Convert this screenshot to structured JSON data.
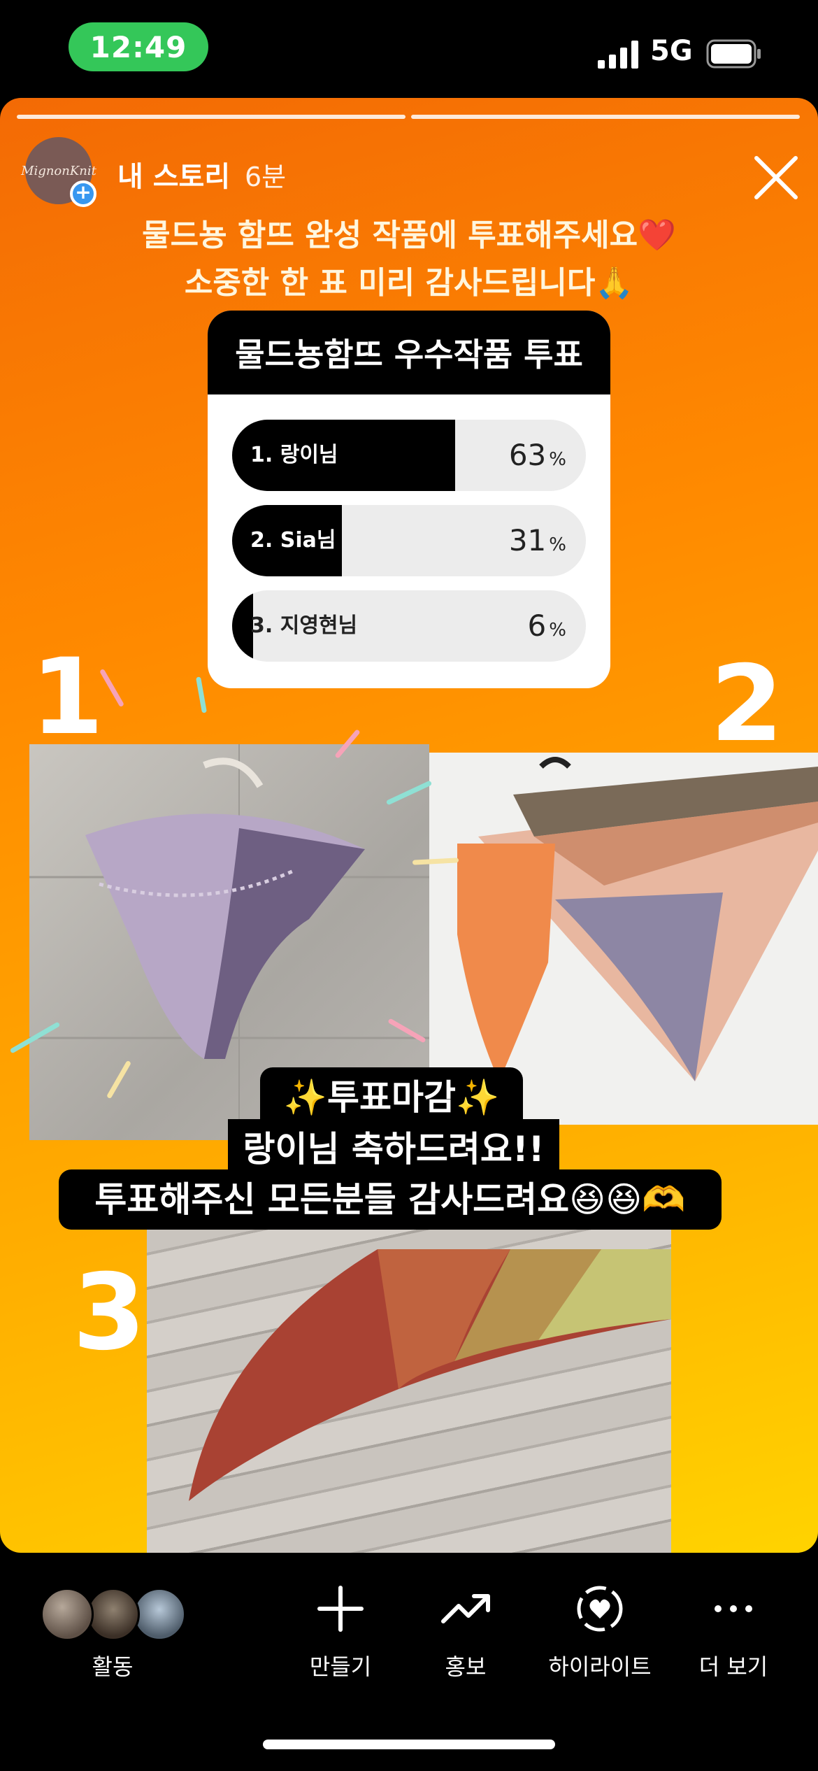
{
  "status_bar": {
    "time": "12:49",
    "network": "5G"
  },
  "story": {
    "username": "내 스토리",
    "time_ago": "6분",
    "avatar_logo": "MignonKnit",
    "caption_line1": "물드뇽 함뜨 완성 작품에 투표해주세요❤️",
    "caption_line2": "소중한 한 표 미리 감사드립니다🙏",
    "poll": {
      "title": "물드뇽함뜨 우수작품 투표",
      "percent_unit": "%",
      "options": [
        {
          "label": "1. 랑이님",
          "percent": "63",
          "fraction": 0.63
        },
        {
          "label": "2. Sia님",
          "percent": "31",
          "fraction": 0.31
        },
        {
          "label": "3. 지영현님",
          "percent": "6",
          "fraction": 0.06
        }
      ]
    },
    "entry_numbers": [
      "1",
      "2",
      "3"
    ],
    "overlay": {
      "line1": "✨투표마감✨",
      "line2": "랑이님 축하드려요!!",
      "line3": "투표해주신 모든분들 감사드려요😆😆🫶"
    }
  },
  "bottom_bar": {
    "activity_label": "활동",
    "create_label": "만들기",
    "promote_label": "홍보",
    "highlight_label": "하이라이트",
    "more_label": "더 보기"
  }
}
